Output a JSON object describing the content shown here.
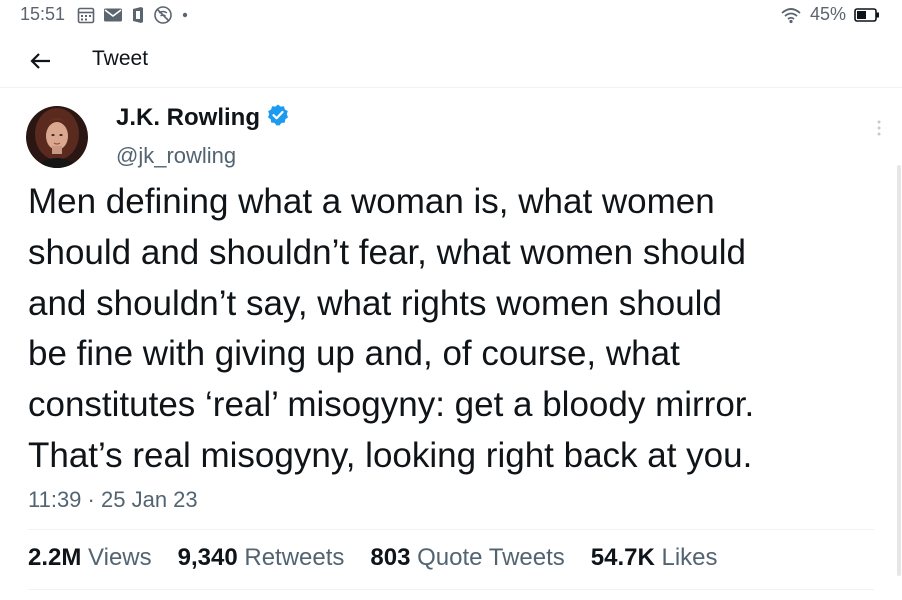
{
  "status_bar": {
    "time": "15:51",
    "battery": "45%",
    "icons": [
      "calendar-icon",
      "mail-icon",
      "office-icon",
      "signal-off-icon",
      "dot-icon",
      "wifi-icon",
      "battery-icon"
    ]
  },
  "header": {
    "back_icon": "back-arrow-icon",
    "title": "Tweet"
  },
  "tweet": {
    "author": {
      "name": "J.K. Rowling",
      "handle": "@jk_rowling",
      "verified": true,
      "verified_color": "#1d9bf0"
    },
    "text_lines": [
      "Men defining what a woman is, what women",
      "should and shouldn’t fear, what women should",
      "and shouldn’t say, what rights women should",
      "be fine with giving up and, of course, what",
      "constitutes ‘real’ misogyny: get a bloody mirror.",
      "That’s real misogyny, looking right back at you."
    ],
    "time": "11:39",
    "separator": "·",
    "date": "25 Jan 23"
  },
  "stats": {
    "views": {
      "num": "2.2M",
      "label": "Views"
    },
    "retweets": {
      "num": "9,340",
      "label": "Retweets"
    },
    "quotes": {
      "num": "803",
      "label": "Quote Tweets"
    },
    "likes": {
      "num": "54.7K",
      "label": "Likes"
    }
  },
  "colors": {
    "text": "#0f1419",
    "secondary": "#536471",
    "divider": "#eff3f4",
    "accent": "#1d9bf0"
  }
}
